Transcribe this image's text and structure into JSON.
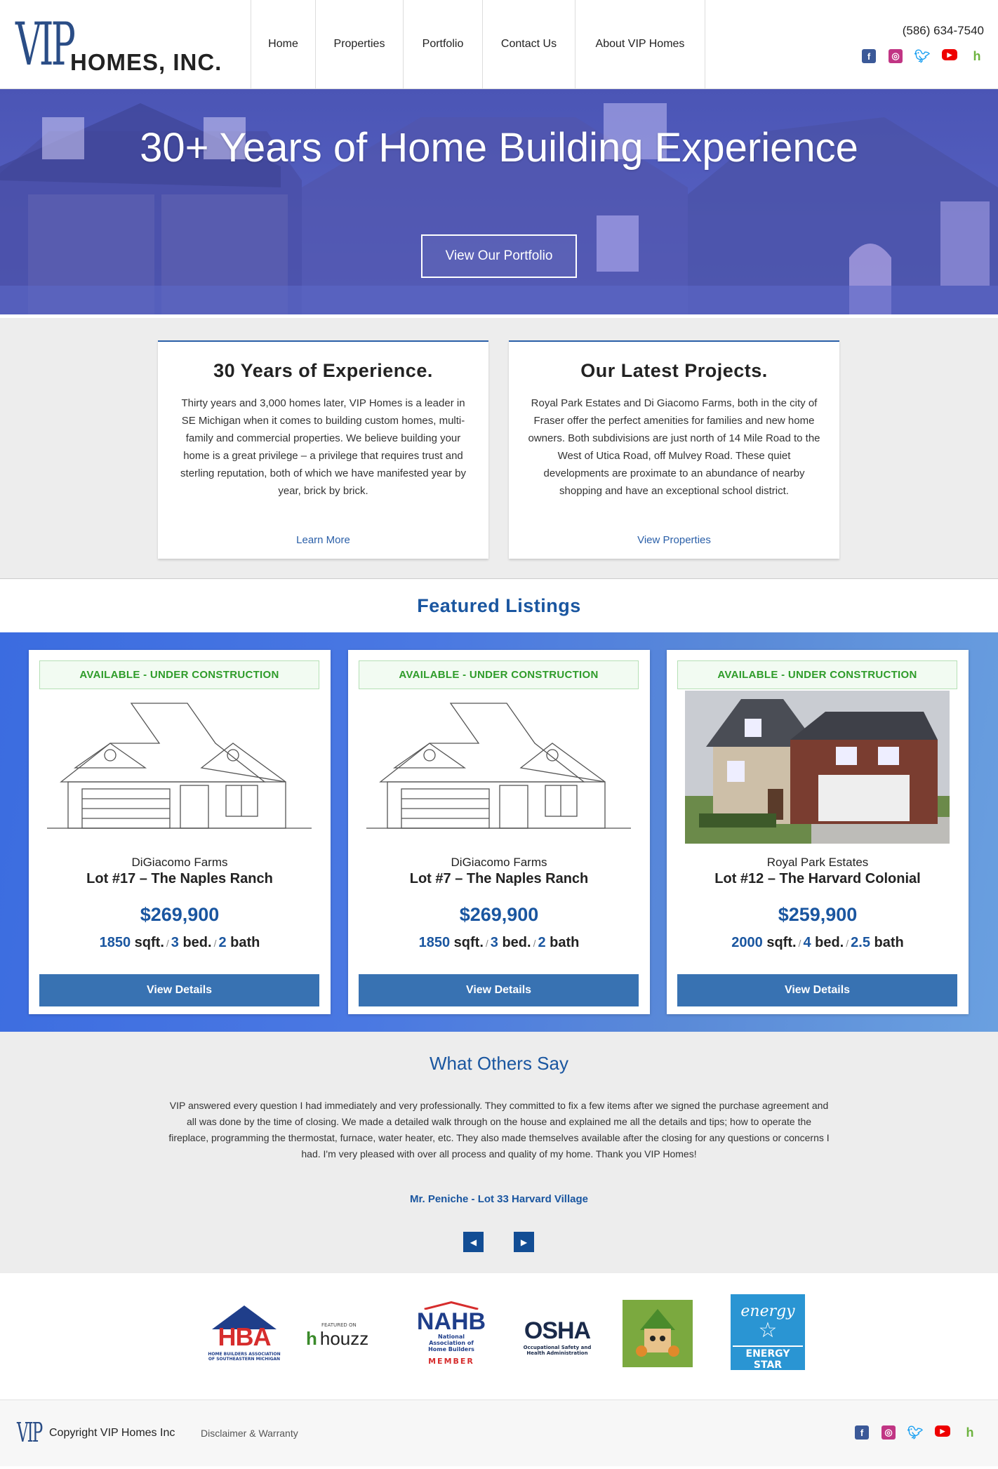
{
  "header": {
    "logo_text_main": "VIP",
    "logo_text_sub": "HOMES, INC.",
    "nav": [
      "Home",
      "Properties",
      "Portfolio",
      "Contact Us",
      "About VIP Homes"
    ],
    "phone": "(586) 634-7540",
    "social_icons": [
      "facebook-icon",
      "instagram-icon",
      "twitter-icon",
      "youtube-icon",
      "houzz-icon"
    ]
  },
  "hero": {
    "title": "30+ Years of Home Building Experience",
    "cta": "View Our Portfolio"
  },
  "info": {
    "experience": {
      "title": "30 Years of Experience.",
      "body": "Thirty years and 3,000 homes later, VIP Homes is a leader in SE Michigan when it comes to building custom homes, multi-family and commercial properties. We believe building your home is a great privilege – a privilege that requires trust and sterling reputation, both of which we have manifested year by year, brick by brick.",
      "link": "Learn More"
    },
    "projects": {
      "title": "Our Latest Projects.",
      "body": "Royal Park Estates and Di Giacomo Farms, both in the city of Fraser offer the perfect amenities for families and new home owners. Both subdivisions are just north of 14 Mile Road to the West of Utica Road, off Mulvey Road. These quiet developments are proximate to an abundance of nearby shopping and have an exceptional school district.",
      "link": "View Properties"
    }
  },
  "featured": {
    "title": "Featured Listings",
    "listings": [
      {
        "badge": "AVAILABLE - UNDER CONSTRUCTION",
        "community": "DiGiacomo Farms",
        "name": "Lot #17 – The Naples Ranch",
        "price": "$269,900",
        "sqft": "1850",
        "sqft_label": "sqft.",
        "beds": "3",
        "beds_label": "bed.",
        "baths": "2",
        "baths_label": "bath",
        "button": "View Details",
        "image": "line-drawing"
      },
      {
        "badge": "AVAILABLE - UNDER CONSTRUCTION",
        "community": "DiGiacomo Farms",
        "name": "Lot #7 – The Naples Ranch",
        "price": "$269,900",
        "sqft": "1850",
        "sqft_label": "sqft.",
        "beds": "3",
        "beds_label": "bed.",
        "baths": "2",
        "baths_label": "bath",
        "button": "View Details",
        "image": "line-drawing"
      },
      {
        "badge": "AVAILABLE - UNDER CONSTRUCTION",
        "community": "Royal Park Estates",
        "name": "Lot #12 – The Harvard Colonial",
        "price": "$259,900",
        "sqft": "2000",
        "sqft_label": "sqft.",
        "beds": "4",
        "beds_label": "bed.",
        "baths": "2.5",
        "baths_label": "bath",
        "button": "View Details",
        "image": "photo"
      }
    ]
  },
  "testimonial": {
    "title": "What Others Say",
    "quote": "VIP answered every question I had immediately and very professionally. They committed to fix a few items after we signed the purchase agreement and all was done by the time of closing. We made a detailed walk through on the house and explained me all the details and tips; how to operate the fireplace, programming the thermostat, furnace, water heater, etc. They also made themselves available after the closing for any questions or concerns I had. I'm very pleased with over all process and quality of my home. Thank you VIP Homes!",
    "author": "Mr. Peniche - Lot 33 Harvard Village",
    "prev_icon": "caret-left-icon",
    "next_icon": "caret-right-icon"
  },
  "partners": {
    "hba": {
      "big": "HBA",
      "small": "HOME BUILDERS ASSOCIATION OF SOUTHEASTERN MICHIGAN"
    },
    "houzz": {
      "top": "FEATURED ON",
      "word": "houzz"
    },
    "nahb": {
      "big": "NAHB",
      "small": "National Association of Home Builders",
      "member": "MEMBER"
    },
    "osha": {
      "big": "OSHA",
      "small": "Occupational Safety and Health Administration"
    },
    "energy": {
      "script": "energy",
      "label": "ENERGY STAR"
    }
  },
  "footer": {
    "logo": "VIP",
    "copyright": "Copyright VIP Homes Inc",
    "disclaimer": "Disclaimer & Warranty"
  },
  "colors": {
    "brand_blue": "#1a56a0",
    "button_blue": "#3872b2",
    "available_green": "#2f9c2a"
  }
}
